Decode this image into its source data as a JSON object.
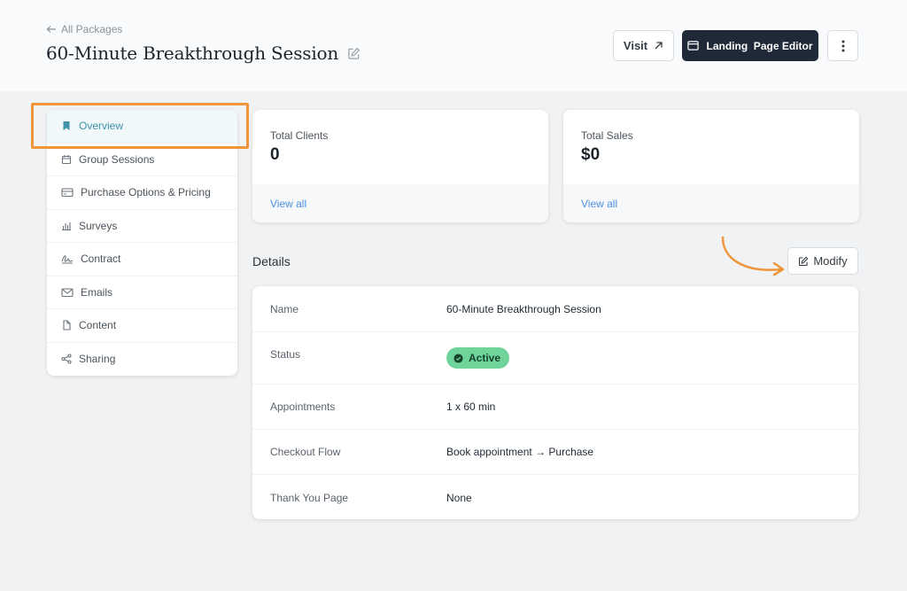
{
  "header": {
    "back_label": "All Packages",
    "title": "60-Minute Breakthrough Session",
    "visit_label": "Visit",
    "editor_label": "Landing  Page Editor"
  },
  "sidebar": {
    "items": [
      {
        "label": "Overview",
        "icon": "bookmark-icon"
      },
      {
        "label": "Group Sessions",
        "icon": "calendar-icon"
      },
      {
        "label": "Purchase Options & Pricing",
        "icon": "credit-card-icon"
      },
      {
        "label": "Surveys",
        "icon": "bar-chart-icon"
      },
      {
        "label": "Contract",
        "icon": "signature-icon"
      },
      {
        "label": "Emails",
        "icon": "mail-icon"
      },
      {
        "label": "Content",
        "icon": "file-icon"
      },
      {
        "label": "Sharing",
        "icon": "share-icon"
      }
    ],
    "active_index": 0
  },
  "stats": [
    {
      "label": "Total Clients",
      "value": "0",
      "link": "View all"
    },
    {
      "label": "Total Sales",
      "value": "$0",
      "link": "View all"
    }
  ],
  "details": {
    "title": "Details",
    "modify_label": "Modify",
    "rows": [
      {
        "key": "Name",
        "value": "60-Minute Breakthrough Session"
      },
      {
        "key": "Status",
        "value": "Active"
      },
      {
        "key": "Appointments",
        "value": "1 x 60 min"
      },
      {
        "key": "Checkout Flow",
        "value": "Book appointment → Purchase"
      },
      {
        "key": "Thank You Page",
        "value": "None"
      }
    ]
  },
  "colors": {
    "accent": "#3e93aa",
    "highlight": "#f0953a",
    "active_badge": "#6fd39a",
    "dark_button": "#1f2937",
    "link": "#4a90e2"
  }
}
